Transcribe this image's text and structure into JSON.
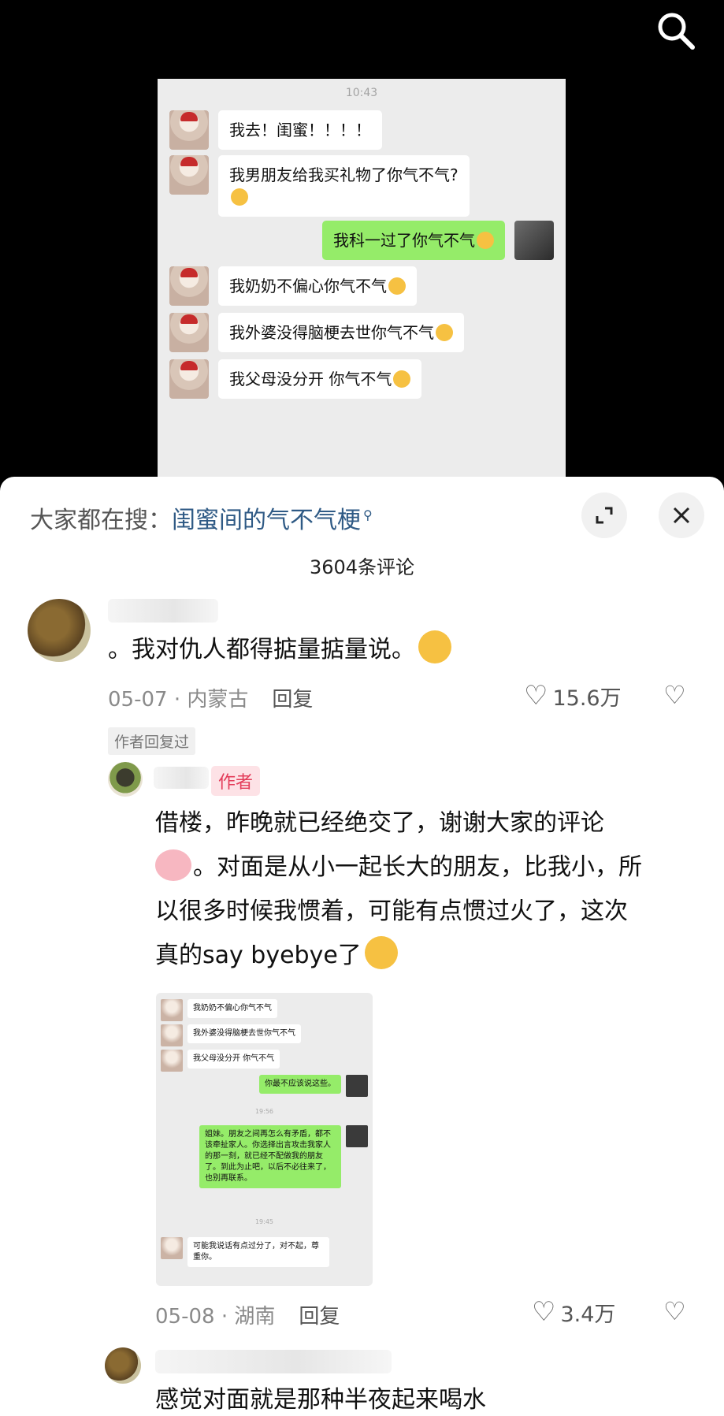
{
  "chat": {
    "time": "10:43",
    "messages": [
      {
        "side": "left",
        "text": "我去！闺蜜！！！！"
      },
      {
        "side": "left",
        "text": "我男朋友给我买礼物了你气不气?"
      },
      {
        "side": "right",
        "text": "我科一过了你气不气"
      },
      {
        "side": "left",
        "text": "我奶奶不偏心你气不气"
      },
      {
        "side": "left",
        "text": "我外婆没得脑梗去世你气不气"
      },
      {
        "side": "left",
        "text": "我父母没分开  你气不气"
      }
    ]
  },
  "sheet": {
    "hot_label": "大家都在搜：",
    "hot_link": "闺蜜间的气不气梗",
    "comment_count": "3604条评论"
  },
  "comment1": {
    "text": "。我对仇人都得掂量掂量说。",
    "date": "05-07",
    "location": "内蒙古",
    "reply": "回复",
    "likes": "15.6万",
    "author_replied_tag": "作者回复过"
  },
  "reply1": {
    "author_tag": "作者",
    "text_line1": "借楼，昨晚就已经绝交了，谢谢大家的评论",
    "text_line2": "。对面是从小一起长大的朋友，比我小，所",
    "text_line3": "以很多时候我惯着，可能有点惯过火了，这次",
    "text_line4": "真的say byebye了",
    "date": "05-08",
    "location": "湖南",
    "reply": "回复",
    "likes": "3.4万"
  },
  "mini_chat": {
    "m1": "我奶奶不偏心你气不气",
    "m2": "我外婆没得脑梗去世你气不气",
    "m3": "我父母没分开  你气不气",
    "m4": "你最不应该说这些。",
    "t1": "19:56",
    "m5": "姐妹。朋友之间再怎么有矛盾，都不该牵扯家人。你选择出言攻击我家人的那一刻，就已经不配做我的朋友了。到此为止吧，以后不必往来了，也别再联系。",
    "t2": "19:45",
    "m6": "可能我说话有点过分了，对不起，尊重你。"
  },
  "comment2": {
    "text": "感觉对面就是那种半夜起来喝水"
  },
  "icons": {
    "search": "search-icon",
    "expand": "expand-icon",
    "close": "close-icon",
    "heart": "heart-icon",
    "broken_heart": "broken-heart-icon"
  }
}
